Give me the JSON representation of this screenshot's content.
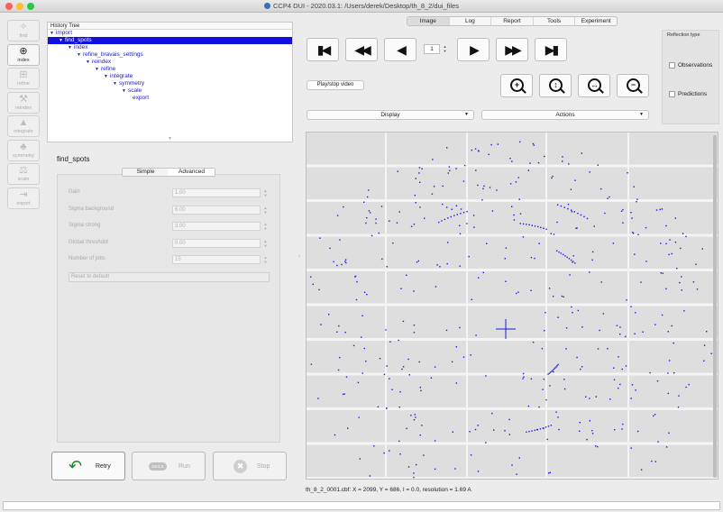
{
  "window": {
    "title": "CCP4 DUI - 2020.03.1: /Users/derek/Desktop/th_8_2/dui_files"
  },
  "toolbar": {
    "items": [
      {
        "label": "find",
        "icon": "magic-wand-icon",
        "glyph": "✧",
        "active": false
      },
      {
        "label": "index",
        "icon": "crosshair-icon",
        "glyph": "⊕",
        "active": true
      },
      {
        "label": "refine",
        "icon": "refine-icon",
        "glyph": "⊞",
        "active": false
      },
      {
        "label": "reindex",
        "icon": "wrench-icon",
        "glyph": "⚒",
        "active": false
      },
      {
        "label": "integrate",
        "icon": "integrate-icon",
        "glyph": "▲",
        "active": false
      },
      {
        "label": "symmetry",
        "icon": "symmetry-icon",
        "glyph": "♣",
        "active": false
      },
      {
        "label": "scale",
        "icon": "scale-icon",
        "glyph": "⚖",
        "active": false
      },
      {
        "label": "export",
        "icon": "export-icon",
        "glyph": "⇥",
        "active": false
      }
    ]
  },
  "history": {
    "header": "History Tree",
    "nodes": [
      {
        "label": "import",
        "depth": 0,
        "selected": false
      },
      {
        "label": "find_spots",
        "depth": 1,
        "selected": true
      },
      {
        "label": "index",
        "depth": 2,
        "selected": false
      },
      {
        "label": "refine_bravais_settings",
        "depth": 3,
        "selected": false
      },
      {
        "label": "reindex",
        "depth": 4,
        "selected": false
      },
      {
        "label": "refine",
        "depth": 5,
        "selected": false
      },
      {
        "label": "integrate",
        "depth": 6,
        "selected": false
      },
      {
        "label": "symmetry",
        "depth": 7,
        "selected": false
      },
      {
        "label": "scale",
        "depth": 8,
        "selected": false
      },
      {
        "label": "export",
        "depth": 9,
        "selected": false
      }
    ]
  },
  "step": {
    "title": "find_spots",
    "tab_simple": "Simple",
    "tab_advanced": "Advanced",
    "params": [
      {
        "label": "Gain",
        "value": "1.00"
      },
      {
        "label": "Sigma background",
        "value": "6.00"
      },
      {
        "label": "Sigma strong",
        "value": "3.00"
      },
      {
        "label": "Global threshold",
        "value": "0.00"
      },
      {
        "label": "Number of jobs",
        "value": "15"
      }
    ],
    "reset_label": "Reset to default"
  },
  "actions": {
    "retry": "Retry",
    "run": "Run",
    "run_logo": "DIALS",
    "stop": "Stop"
  },
  "main_tabs": [
    "Image",
    "Log",
    "Report",
    "Tools",
    "Experiment"
  ],
  "nav": {
    "frame": "1"
  },
  "play_label": "Play/stop video",
  "display_label": "Display",
  "actions_label": "Actions",
  "reflection": {
    "title": "Reflection type",
    "observations": "Observations",
    "predictions": "Predictions"
  },
  "colors": {
    "spot": "#1a1ae0",
    "selection": "#1010e0",
    "retry_arrow": "#1d8a2a"
  },
  "status": {
    "text": "th_8_2_0001.cbf: X = 2099, Y = 686, I = 0.0, resolution = 1.69 A"
  }
}
